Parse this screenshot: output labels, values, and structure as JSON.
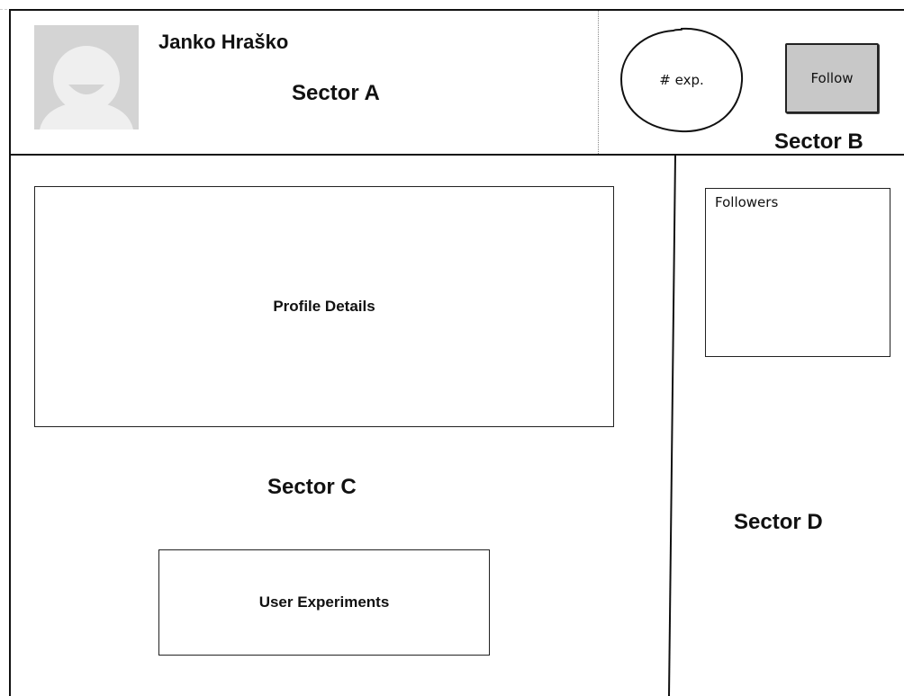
{
  "sector_a": {
    "user_name": "Janko Hraško",
    "label": "Sector A"
  },
  "sector_b": {
    "experiments_bubble": "# exp.",
    "follow_button": "Follow",
    "label": "Sector B"
  },
  "sector_c": {
    "profile_details": "Profile Details",
    "label": "Sector C",
    "user_experiments": "User Experiments"
  },
  "sector_d": {
    "followers_title": "Followers",
    "label": "Sector D"
  }
}
